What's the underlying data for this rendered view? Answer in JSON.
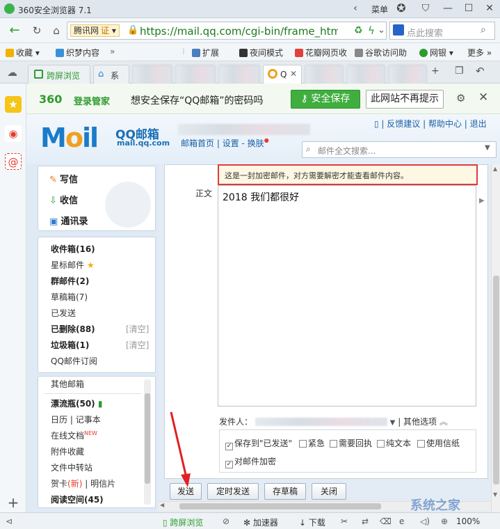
{
  "browser": {
    "title": "360安全浏览器 7.1",
    "menu_label": "菜单",
    "url_tag": "腾讯网",
    "url_badge": "证",
    "url": "https://mail.qq.com/cgi-bin/frame_htm",
    "search_placeholder": "点此搜索"
  },
  "bookmarks": {
    "left": [
      {
        "label": "收藏",
        "icon": "star-icon",
        "color": "#f2b200"
      },
      {
        "label": "织梦内容",
        "icon": "bookmark-icon",
        "color": "#3a8fd8"
      }
    ],
    "right": [
      {
        "label": "扩展",
        "icon": "extension-icon",
        "color": "#4a7fc0"
      },
      {
        "label": "夜间模式",
        "icon": "moon-icon",
        "color": "#333333"
      },
      {
        "label": "花瓣网页收",
        "icon": "petal-icon",
        "color": "#e24040"
      },
      {
        "label": "谷歌访问助",
        "icon": "google-icon",
        "color": "#888888"
      },
      {
        "label": "网银",
        "icon": "bank-icon",
        "color": "#2e9b2f"
      },
      {
        "label": "更多",
        "icon": "more-icon",
        "color": "#666666"
      }
    ]
  },
  "tabs": [
    {
      "label": "跨屏浏览"
    },
    {
      "label": "系"
    },
    {
      "label": "Q"
    }
  ],
  "notify": {
    "brand": "360",
    "brand_suffix": "登录管家",
    "message": "想安全保存“QQ邮箱”的密码吗",
    "save_label": "安全保存",
    "dismiss_label": "此网站不再提示"
  },
  "mail": {
    "brand_title": "QQ邮箱",
    "brand_domain": "mail.qq.com",
    "nav": [
      "邮箱首页",
      "设置",
      "换肤"
    ],
    "top_links": [
      "反馈建议",
      "帮助中心",
      "退出"
    ],
    "search_placeholder": "邮件全文搜索..."
  },
  "left_nav": {
    "actions": [
      {
        "label": "写信",
        "icon": "pencil-icon"
      },
      {
        "label": "收信",
        "icon": "inbox-icon"
      },
      {
        "label": "通讯录",
        "icon": "contacts-icon"
      }
    ],
    "folders": [
      {
        "label": "收件箱(16)",
        "bold": true
      },
      {
        "label": "星标邮件",
        "bold": false,
        "star": true
      },
      {
        "label": "群邮件(2)",
        "bold": true
      },
      {
        "label": "草稿箱(7)",
        "bold": false
      },
      {
        "label": "已发送",
        "bold": false
      },
      {
        "label": "已删除(88)",
        "bold": true,
        "clear": "[清空]"
      },
      {
        "label": "垃圾箱(1)",
        "bold": true,
        "clear": "[清空]"
      },
      {
        "label": "QQ邮件订阅",
        "bold": false
      }
    ],
    "other": {
      "header": "其他邮箱",
      "drift": "漂流瓶(50)",
      "calendar": "日历",
      "notes": "记事本",
      "docs": "在线文档",
      "docs_badge": "NEW",
      "attachments": "附件收藏",
      "transfer": "文件中转站",
      "cards": "贺卡",
      "cards_badge": "(新)",
      "postcards": "明信片",
      "reading": "阅读空间(45)"
    }
  },
  "compose": {
    "warning": "这是一封加密邮件，对方需要解密才能查看邮件内容。",
    "body_label": "正文",
    "body_text": "2018 我们都很好",
    "sender_label": "发件人：",
    "other_options": "其他选项",
    "options": [
      {
        "label": "保存到\"已发送\"",
        "checked": true
      },
      {
        "label": "紧急",
        "checked": false
      },
      {
        "label": "需要回执",
        "checked": false
      },
      {
        "label": "纯文本",
        "checked": false
      },
      {
        "label": "使用信纸",
        "checked": false
      },
      {
        "label": "对邮件加密",
        "checked": true
      }
    ],
    "buttons": {
      "send": "发送",
      "schedule": "定时发送",
      "draft": "存草稿",
      "close": "关闭"
    }
  },
  "status": {
    "cross_screen": "跨屏浏览",
    "accelerator": "加速器",
    "download": "下载",
    "zoom": "100%"
  },
  "watermark": "系统之家"
}
